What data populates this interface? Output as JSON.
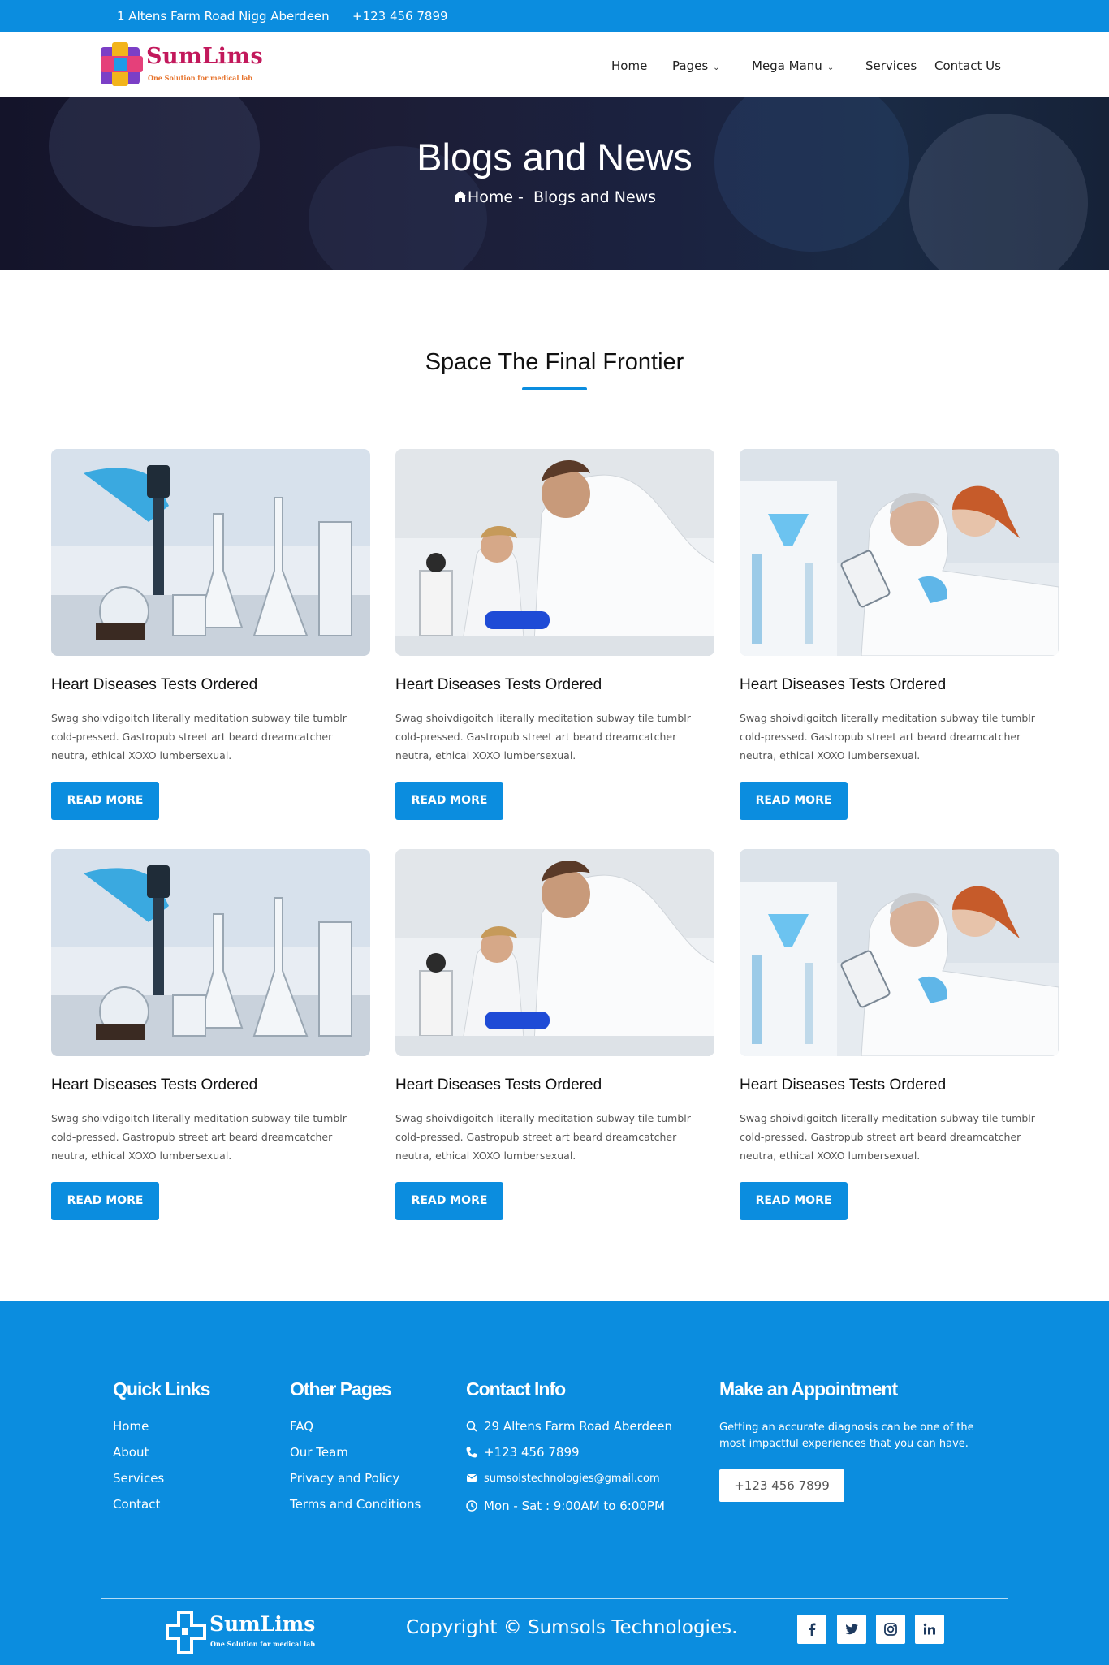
{
  "topbar": {
    "address": "1 Altens Farm Road Nigg Aberdeen",
    "phone": "+123 456 7899"
  },
  "brand": {
    "name": "SumLims",
    "tagline": "One Solution for medical lab"
  },
  "nav": {
    "home": "Home",
    "pages": "Pages",
    "mega": "Mega Manu",
    "services": "Services",
    "contact": "Contact Us"
  },
  "hero": {
    "title": "Blogs and News",
    "crumb_home": "Home -",
    "crumb_current": "Blogs and News"
  },
  "section": {
    "title": "Space The Final Frontier"
  },
  "posts": [
    {
      "title": "Heart Diseases Tests Ordered",
      "excerpt": "Swag shoivdigoitch literally meditation subway tile tumblr cold-pressed. Gastropub street art beard dreamcatcher neutra, ethical XOXO lumbersexual.",
      "button": "READ MORE",
      "image": "lab-glassware-pipette"
    },
    {
      "title": "Heart Diseases Tests Ordered",
      "excerpt": "Swag shoivdigoitch literally meditation subway tile tumblr cold-pressed. Gastropub street art beard dreamcatcher neutra, ethical XOXO lumbersexual.",
      "button": "READ MORE",
      "image": "scientists-microscope"
    },
    {
      "title": "Heart Diseases Tests Ordered",
      "excerpt": "Swag shoivdigoitch literally meditation subway tile tumblr cold-pressed. Gastropub street art beard dreamcatcher neutra, ethical XOXO lumbersexual.",
      "button": "READ MORE",
      "image": "scientists-tablet"
    },
    {
      "title": "Heart Diseases Tests Ordered",
      "excerpt": "Swag shoivdigoitch literally meditation subway tile tumblr cold-pressed. Gastropub street art beard dreamcatcher neutra, ethical XOXO lumbersexual.",
      "button": "READ MORE",
      "image": "lab-glassware-pipette"
    },
    {
      "title": "Heart Diseases Tests Ordered",
      "excerpt": "Swag shoivdigoitch literally meditation subway tile tumblr cold-pressed. Gastropub street art beard dreamcatcher neutra, ethical XOXO lumbersexual.",
      "button": "READ MORE",
      "image": "scientists-microscope"
    },
    {
      "title": "Heart Diseases Tests Ordered",
      "excerpt": "Swag shoivdigoitch literally meditation subway tile tumblr cold-pressed. Gastropub street art beard dreamcatcher neutra, ethical XOXO lumbersexual.",
      "button": "READ MORE",
      "image": "scientists-tablet"
    }
  ],
  "footer": {
    "quick_links": {
      "heading": "Quick Links",
      "items": [
        "Home",
        "About",
        "Services",
        "Contact"
      ]
    },
    "other_pages": {
      "heading": "Other Pages",
      "items": [
        "FAQ",
        "Our Team",
        "Privacy and Policy",
        "Terms and Conditions"
      ]
    },
    "contact": {
      "heading": "Contact Info",
      "address": "29 Altens Farm Road Aberdeen",
      "phone": "+123 456 7899",
      "email": "sumsolstechnologies@gmail.com",
      "hours": "Mon - Sat : 9:00AM to 6:00PM"
    },
    "appointment": {
      "heading": "Make an Appointment",
      "text": "Getting an accurate diagnosis can be one of the most impactful experiences that you can have.",
      "button": "+123 456 7899"
    },
    "copyright": "Copyright © Sumsols Technologies.",
    "social": [
      "facebook-icon",
      "twitter-icon",
      "instagram-icon",
      "linkedin-icon"
    ]
  },
  "colors": {
    "primary": "#0b8ddf",
    "hero_bg": "#1c1d36"
  }
}
